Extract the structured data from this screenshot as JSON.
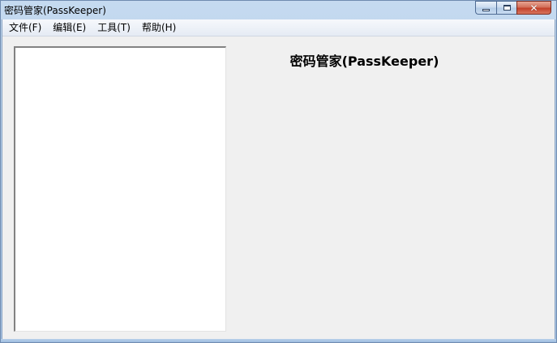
{
  "window": {
    "title": "密码管家(PassKeeper)"
  },
  "controls": {
    "minimize_icon": "minimize-icon",
    "maximize_icon": "maximize-icon",
    "close_icon": "close-icon",
    "close_glyph": "✕"
  },
  "menubar": {
    "items": [
      {
        "label": "文件(F)"
      },
      {
        "label": "编辑(E)"
      },
      {
        "label": "工具(T)"
      },
      {
        "label": "帮助(H)"
      }
    ]
  },
  "main": {
    "heading": "密码管家(PassKeeper)"
  },
  "colors": {
    "client_bg": "#f0f0f0",
    "close_button": "#c2412a",
    "titlebar": "#b5cfea"
  }
}
